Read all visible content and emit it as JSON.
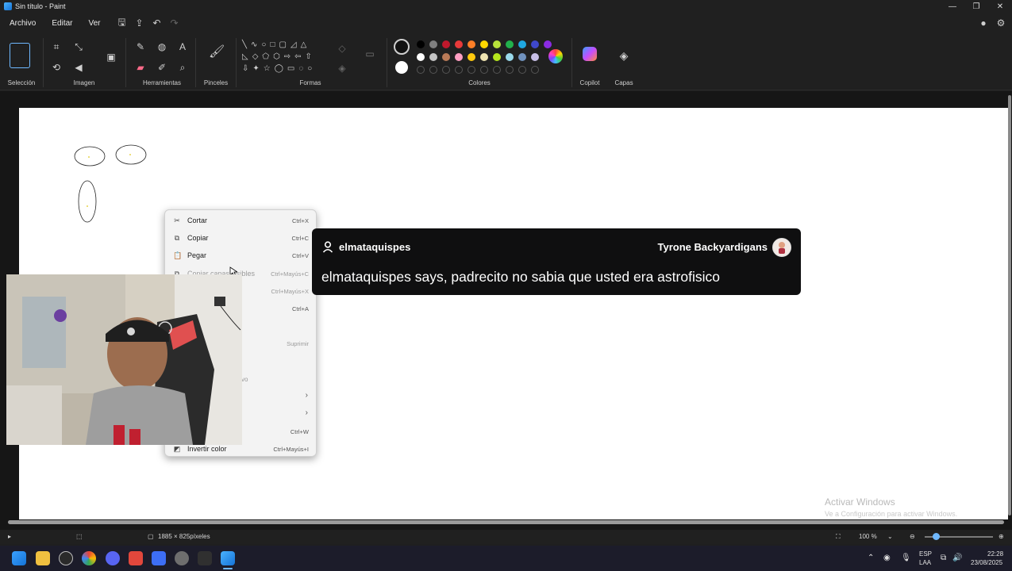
{
  "window": {
    "title": "Sin título - Paint",
    "controls": {
      "minimize": "—",
      "maximize": "❐",
      "close": "✕"
    }
  },
  "menubar": {
    "items": [
      "Archivo",
      "Editar",
      "Ver"
    ]
  },
  "ribbon": {
    "groups": {
      "seleccion": "Selección",
      "imagen": "Imagen",
      "herramientas": "Herramientas",
      "pinceles": "Pinceles",
      "formas": "Formas",
      "colores": "Colores",
      "copilot": "Copilot",
      "capas": "Capas"
    },
    "colors": {
      "primary": "#111111",
      "secondary": "#ffffff",
      "row1": [
        "#000000",
        "#7f7f7f",
        "#c0182c",
        "#e83a3a",
        "#ff7f27",
        "#ffd800",
        "#b8e23a",
        "#22b14c",
        "#1fa7e0",
        "#3f48cc",
        "#8a2be2"
      ],
      "row2": [
        "#ffffff",
        "#c3c3c3",
        "#b97a57",
        "#ff9ec2",
        "#ffc90e",
        "#efe4b0",
        "#b5e61d",
        "#99d9ea",
        "#7092be",
        "#c8bfe7"
      ]
    }
  },
  "context_menu": {
    "items": [
      {
        "label": "Cortar",
        "shortcut": "Ctrl+X",
        "icon": "scissors-icon"
      },
      {
        "label": "Copiar",
        "shortcut": "Ctrl+C",
        "icon": "copy-icon"
      },
      {
        "label": "Pegar",
        "shortcut": "Ctrl+V",
        "icon": "paste-icon"
      },
      {
        "label": "Copiar capas visibles",
        "shortcut": "Ctrl+Mayús+C",
        "icon": "layers-copy-icon"
      },
      {
        "label": "",
        "shortcut": "Ctrl+Mayús+X"
      },
      {
        "label": "",
        "shortcut": "Ctrl+A"
      },
      {
        "label": "",
        "shortcut": "Suprimir"
      },
      {
        "label": "",
        "shortcut": "Ctrl+W"
      },
      {
        "label": "Invertir color",
        "shortcut": "Ctrl+Mayús+I",
        "icon": "invert-icon"
      }
    ],
    "partial_text": "vo"
  },
  "chat": {
    "username": "elmataquispes",
    "channel": "Tyrone Backyardigans",
    "message": "elmataquispes says, padrecito no sabia que usted era astrofisico"
  },
  "watermark": {
    "line1": "Activar Windows",
    "line2": "Ve a Configuración para activar Windows."
  },
  "statusbar": {
    "canvas_size": "1885 × 825píxeles",
    "zoom": "100 %"
  },
  "taskbar": {
    "language": "ESP",
    "region": "LAA",
    "time": "22:28",
    "date": "23/08/2025"
  }
}
